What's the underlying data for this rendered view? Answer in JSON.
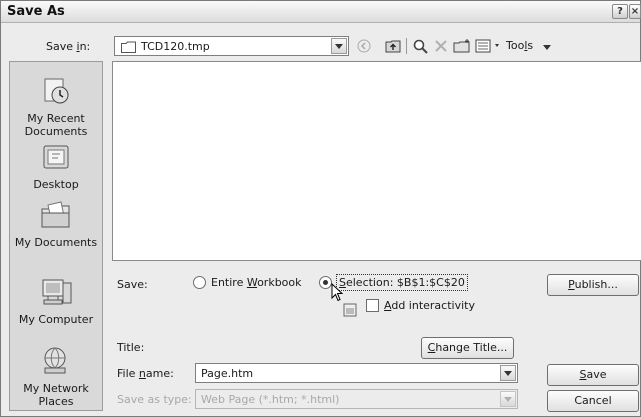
{
  "window": {
    "title": "Save As",
    "help_glyph": "?",
    "close_glyph": "×"
  },
  "location": {
    "label_pre": "Save ",
    "label_key": "i",
    "label_post": "n:",
    "folder": "TCD120.tmp",
    "tools_pre": "Too",
    "tools_key": "l",
    "tools_post": "s"
  },
  "places": [
    {
      "line1": "My Recent",
      "line2": "Documents",
      "icon": "recent-documents-icon"
    },
    {
      "line1": "Desktop",
      "line2": "",
      "icon": "desktop-icon"
    },
    {
      "line1": "My Documents",
      "line2": "",
      "icon": "my-documents-icon"
    },
    {
      "line1": "My Computer",
      "line2": "",
      "icon": "my-computer-icon"
    },
    {
      "line1": "My Network",
      "line2": "Places",
      "icon": "network-places-icon"
    }
  ],
  "save_options": {
    "label": "Save:",
    "entire_pre": "Entire ",
    "entire_key": "W",
    "entire_post": "orkbook",
    "selection_pre": "",
    "selection_key": "S",
    "selection_post": "election: $B$1:$C$20",
    "selected": "selection",
    "interactivity_pre": "",
    "interactivity_key": "A",
    "interactivity_post": "dd interactivity",
    "interactivity_checked": false
  },
  "title_row": {
    "label": "Title:",
    "button_pre": "",
    "button_key": "C",
    "button_post": "hange Title..."
  },
  "filename": {
    "label_pre": "File ",
    "label_key": "n",
    "label_post": "ame:",
    "value": "Page.htm"
  },
  "savetype": {
    "label": "Save as type:",
    "value": "Web Page (*.htm; *.html)"
  },
  "buttons": {
    "publish_pre": "",
    "publish_key": "P",
    "publish_post": "ublish...",
    "save_pre": "",
    "save_key": "S",
    "save_post": "ave",
    "cancel": "Cancel"
  }
}
